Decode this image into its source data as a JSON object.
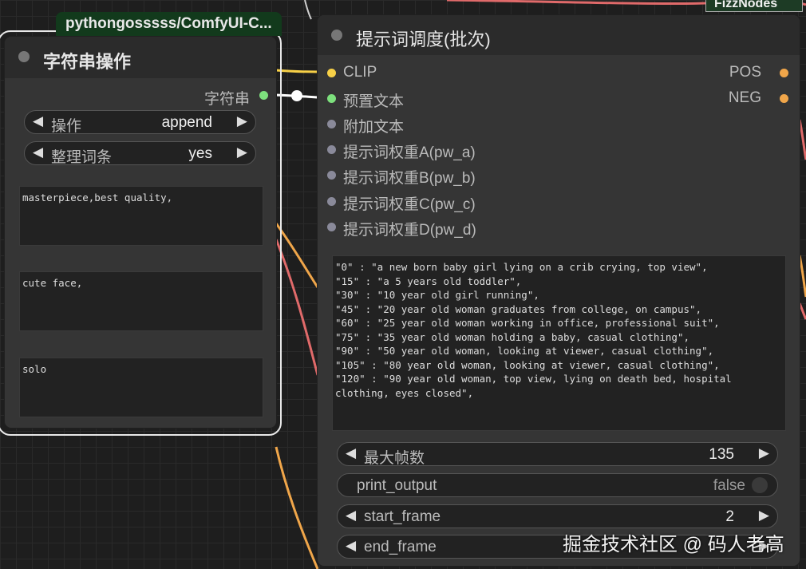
{
  "colors": {
    "clip_port": "#f7d047",
    "string_port": "#7de07d",
    "float_port": "#8a8a9a",
    "conditioning_port": "#f0a64a",
    "wire_red": "#e06a6a",
    "wire_orange": "#f0a64a",
    "wire_yellow": "#f7d047"
  },
  "badges": {
    "left_node_source": "pythongosssss/ComfyUI-C...",
    "fizznodes": "FizzNodes"
  },
  "left_node": {
    "title": "字符串操作",
    "output_label": "字符串",
    "widgets": [
      {
        "label": "操作",
        "value": "append"
      },
      {
        "label": "整理词条",
        "value": "yes"
      }
    ],
    "text_boxes": [
      "masterpiece,best quality,",
      "cute face,",
      "solo"
    ]
  },
  "right_node": {
    "title": "提示词调度(批次)",
    "inputs": [
      {
        "label": "CLIP",
        "type": "clip"
      },
      {
        "label": "预置文本",
        "type": "string"
      },
      {
        "label": "附加文本",
        "type": "float"
      },
      {
        "label": "提示词权重A(pw_a)",
        "type": "float"
      },
      {
        "label": "提示词权重B(pw_b)",
        "type": "float"
      },
      {
        "label": "提示词权重C(pw_c)",
        "type": "float"
      },
      {
        "label": "提示词权重D(pw_d)",
        "type": "float"
      }
    ],
    "outputs": [
      {
        "label": "POS"
      },
      {
        "label": "NEG"
      }
    ],
    "schedule_text": "\"0\" : \"a new born baby girl lying on a crib crying, top view\",\n\"15\" : \"a 5 years old toddler\",\n\"30\" : \"10 year old girl running\",\n\"45\" : \"20 year old woman graduates from college, on campus\",\n\"60\" : \"25 year old woman working in office, professional suit\",\n\"75\" : \"35 year old woman holding a baby, casual clothing\",\n\"90\" : \"50 year old woman, looking at viewer, casual clothing\",\n\"105\" : \"80 year old woman, looking at viewer, casual clothing\",\n\"120\" : \"90 year old woman, top view, lying on death bed, hospital clothing, eyes closed\",",
    "widgets": {
      "max_frames": {
        "label": "最大帧数",
        "value": "135"
      },
      "print_output": {
        "label": "print_output",
        "value": "false"
      },
      "start_frame": {
        "label": "start_frame",
        "value": "2"
      },
      "end_frame": {
        "label": "end_frame",
        "value": ""
      }
    }
  },
  "icons": {
    "arrow_left": "◀",
    "arrow_right": "▶"
  },
  "watermark": "掘金技术社区 @ 码人老高"
}
